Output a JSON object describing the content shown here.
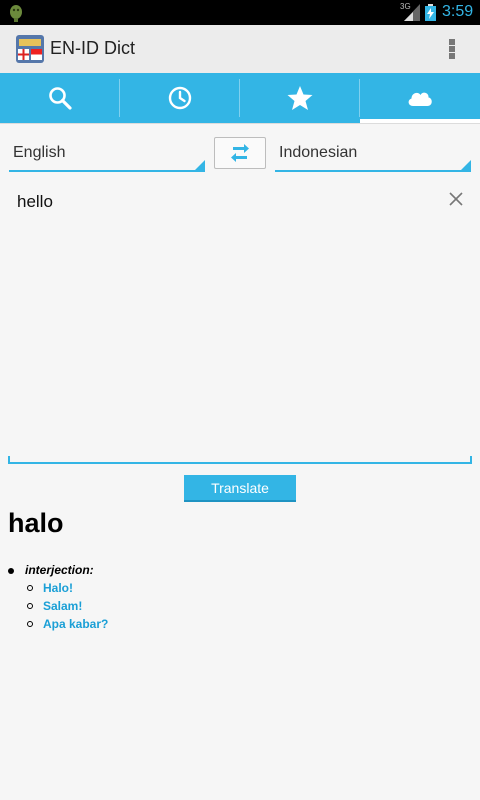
{
  "status_bar": {
    "network": "3G",
    "time": "3:59"
  },
  "app_bar": {
    "title": "EN-ID Dict"
  },
  "tabs": [
    {
      "icon": "search-icon"
    },
    {
      "icon": "history-clock-icon"
    },
    {
      "icon": "favorites-star-icon"
    },
    {
      "icon": "cloud-icon",
      "selected": true
    }
  ],
  "languages": {
    "source": "English",
    "target": "Indonesian"
  },
  "input": {
    "value": "hello"
  },
  "translate_button": {
    "label": "Translate"
  },
  "result": {
    "word": "halo",
    "part_of_speech": "interjection:",
    "translations": [
      "Halo!",
      "Salam!",
      "Apa kabar?"
    ]
  },
  "colors": {
    "accent": "#33b5e5",
    "link": "#1a9fd6",
    "background": "#f6f6f6"
  }
}
